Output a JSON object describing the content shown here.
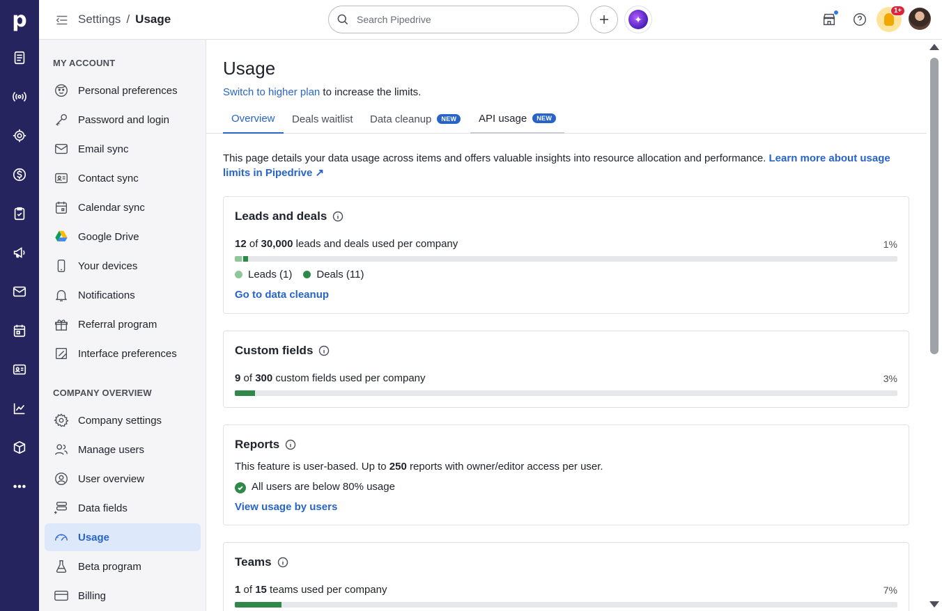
{
  "rail": {
    "logo": "p",
    "items": [
      "leads-icon",
      "deals-icon",
      "campaigns-icon",
      "money-icon",
      "tasks-icon",
      "megaphone-icon",
      "mail-icon",
      "calendar-icon",
      "contacts-icon",
      "insights-icon",
      "products-icon",
      "more-icon"
    ]
  },
  "header": {
    "breadcrumb_parent": "Settings",
    "breadcrumb_sep": "/",
    "breadcrumb_current": "Usage",
    "search_placeholder": "Search Pipedrive",
    "tips_badge": "1+"
  },
  "sidebar": {
    "section_account": "MY ACCOUNT",
    "account_items": [
      {
        "label": "Personal preferences",
        "icon": "face-icon"
      },
      {
        "label": "Password and login",
        "icon": "key-icon"
      },
      {
        "label": "Email sync",
        "icon": "envelope-icon"
      },
      {
        "label": "Contact sync",
        "icon": "contact-card-icon"
      },
      {
        "label": "Calendar sync",
        "icon": "calendar-icon"
      },
      {
        "label": "Google Drive",
        "icon": "google-drive-icon"
      },
      {
        "label": "Your devices",
        "icon": "phone-icon"
      },
      {
        "label": "Notifications",
        "icon": "bell-icon"
      },
      {
        "label": "Referral program",
        "icon": "gift-icon"
      },
      {
        "label": "Interface preferences",
        "icon": "interface-icon"
      }
    ],
    "section_company": "COMPANY OVERVIEW",
    "company_items": [
      {
        "label": "Company settings",
        "icon": "gear-icon"
      },
      {
        "label": "Manage users",
        "icon": "users-icon"
      },
      {
        "label": "User overview",
        "icon": "user-circle-icon"
      },
      {
        "label": "Data fields",
        "icon": "data-fields-icon"
      },
      {
        "label": "Usage",
        "icon": "gauge-icon",
        "active": true
      },
      {
        "label": "Beta program",
        "icon": "flask-icon"
      },
      {
        "label": "Billing",
        "icon": "credit-card-icon"
      }
    ]
  },
  "main": {
    "title": "Usage",
    "upgrade_link": "Switch to higher plan",
    "upgrade_rest": " to increase the limits.",
    "tabs": [
      {
        "label": "Overview"
      },
      {
        "label": "Deals waitlist"
      },
      {
        "label": "Data cleanup",
        "badge": "NEW"
      },
      {
        "label": "API usage",
        "badge": "NEW"
      }
    ],
    "intro_text": "This page details your data usage across items and offers valuable insights into resource allocation and performance. ",
    "intro_link": "Learn more about usage limits in Pipedrive ↗",
    "cards": {
      "leads": {
        "title": "Leads and deals",
        "used": "12",
        "of": " of ",
        "limit": "30,000",
        "suffix": " leads and deals used per company",
        "percent": "1%",
        "leads_fraction": 0.0003,
        "deals_fraction": 0.0004,
        "legend_leads": "Leads (1)",
        "legend_deals": "Deals (11)",
        "link": "Go to data cleanup",
        "color_leads": "#8fc79a",
        "color_deals": "#2f8a4a"
      },
      "custom": {
        "title": "Custom fields",
        "used": "9",
        "of": " of ",
        "limit": "300",
        "suffix": " custom fields used per company",
        "percent": "3%",
        "fraction": 0.03
      },
      "reports": {
        "title": "Reports",
        "desc_pre": "This feature is user-based. Up to ",
        "desc_num": "250",
        "desc_post": " reports with owner/editor access per user.",
        "status": "All users are below 80% usage",
        "link": "View usage by users"
      },
      "teams": {
        "title": "Teams",
        "used": "1",
        "of": " of ",
        "limit": "15",
        "suffix": " teams used per company",
        "percent": "7%",
        "fraction": 0.07
      }
    }
  },
  "colors": {
    "rail": "#26245f",
    "accent": "#2864c8",
    "progress": "#2f8a4a"
  }
}
